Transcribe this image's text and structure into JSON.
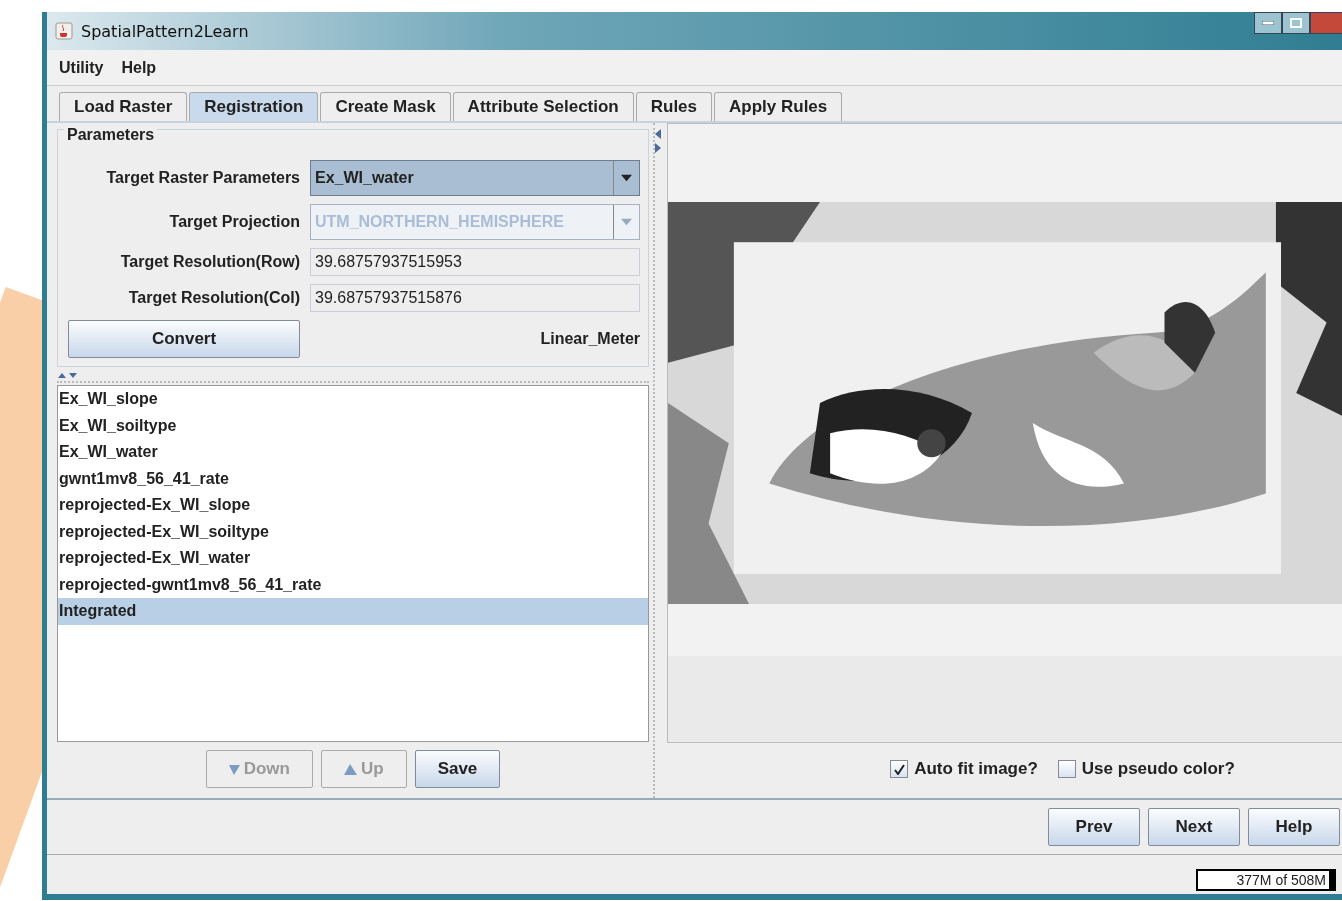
{
  "window": {
    "title": "SpatialPattern2Learn"
  },
  "menu": [
    "Utility",
    "Help"
  ],
  "tabs": [
    {
      "label": "Load Raster",
      "selected": false
    },
    {
      "label": "Registration",
      "selected": true
    },
    {
      "label": "Create Mask",
      "selected": false
    },
    {
      "label": "Attribute Selection",
      "selected": false
    },
    {
      "label": "Rules",
      "selected": false
    },
    {
      "label": "Apply Rules",
      "selected": false
    }
  ],
  "parameters": {
    "title": "Parameters",
    "fields": [
      {
        "kind": "combo",
        "label": "Target Raster Parameters",
        "value": "Ex_WI_water",
        "disabled": false
      },
      {
        "kind": "combo",
        "label": "Target Projection",
        "value": "UTM_NORTHERN_HEMISPHERE",
        "disabled": true
      },
      {
        "kind": "text",
        "label": "Target Resolution(Row)",
        "value": "39.68757937515953",
        "disabled": false
      },
      {
        "kind": "text",
        "label": "Target Resolution(Col)",
        "value": "39.68757937515876",
        "disabled": false
      }
    ],
    "convert_button": "Convert",
    "unit": "Linear_Meter"
  },
  "layers": [
    {
      "label": "Ex_WI_slope",
      "selected": false
    },
    {
      "label": "Ex_WI_soiltype",
      "selected": false
    },
    {
      "label": "Ex_WI_water",
      "selected": false
    },
    {
      "label": "gwnt1mv8_56_41_rate",
      "selected": false
    },
    {
      "label": "reprojected-Ex_WI_slope",
      "selected": false
    },
    {
      "label": "reprojected-Ex_WI_soiltype",
      "selected": false
    },
    {
      "label": "reprojected-Ex_WI_water",
      "selected": false
    },
    {
      "label": "reprojected-gwnt1mv8_56_41_rate",
      "selected": false
    },
    {
      "label": "Integrated",
      "selected": true
    }
  ],
  "list_buttons": [
    {
      "kind": "down",
      "label": "Down",
      "disabled": true
    },
    {
      "kind": "up",
      "label": "Up",
      "disabled": true
    },
    {
      "kind": "plain",
      "label": "Save",
      "disabled": false
    }
  ],
  "preview": {
    "kind": "picture",
    "options": [
      {
        "label": "Auto fit image?",
        "checked": true
      },
      {
        "label": "Use pseudo color?",
        "checked": false
      }
    ]
  },
  "nav_buttons": [
    "Prev",
    "Next",
    "Help"
  ],
  "status_bar": {
    "memory": "377M of 508M"
  }
}
